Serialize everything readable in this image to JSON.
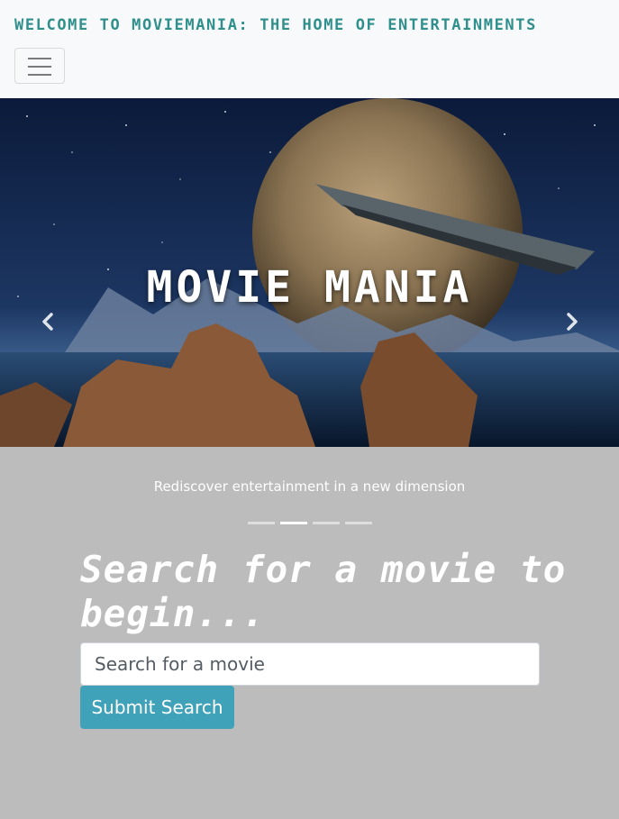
{
  "navbar": {
    "brand": "Welcome to MovieMania: The Home of Entertainments",
    "toggler_icon": "hamburger-icon"
  },
  "hero": {
    "title": "MOVIE MANIA",
    "caption": "Rediscover entertainment in a new dimension",
    "prev_icon": "chevron-left-icon",
    "next_icon": "chevron-right-icon",
    "indicators": {
      "count": 4,
      "active_index": 1
    }
  },
  "search": {
    "heading": "Search for a movie to begin...",
    "placeholder": "Search for a movie",
    "value": "",
    "submit_label": "Submit Search"
  },
  "colors": {
    "brand_text": "#2f8f8c",
    "page_background": "#bcbcbc",
    "button": "#3fa2b8"
  }
}
